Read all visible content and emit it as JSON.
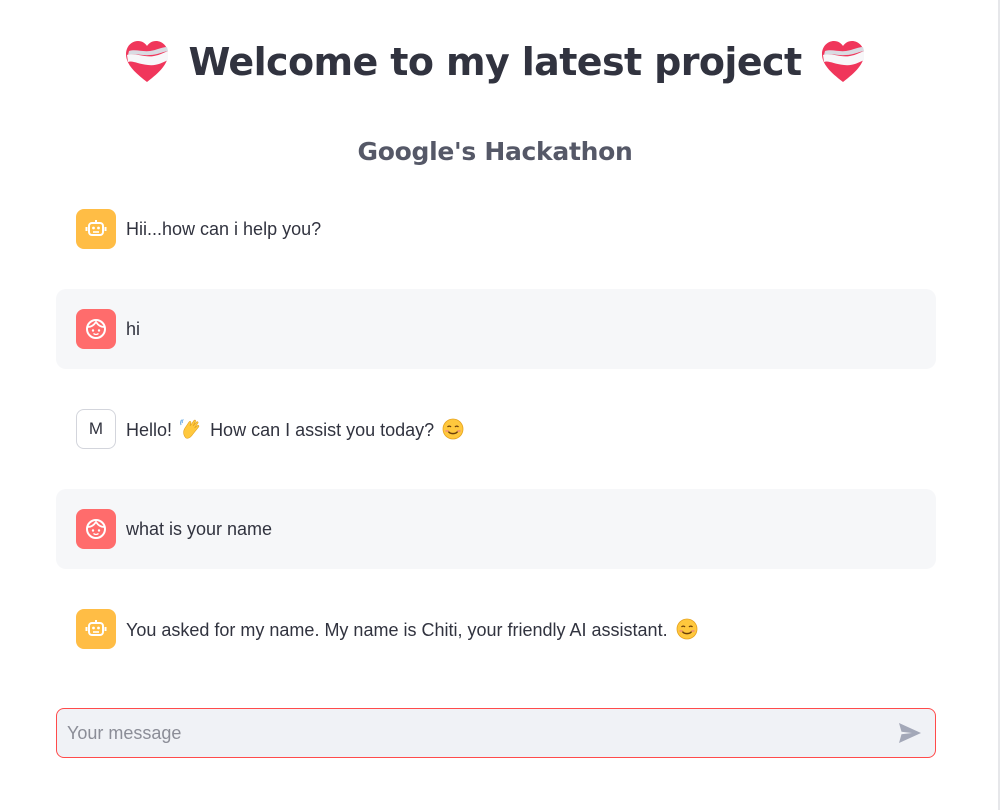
{
  "header": {
    "title": "Welcome to my latest project",
    "subtitle": "Google's Hackathon",
    "title_icon": "heart-ribbon-icon"
  },
  "messages": [
    {
      "role": "assistant",
      "avatar": "robot-icon",
      "text": "Hii...how can i help you?"
    },
    {
      "role": "user",
      "avatar": "user-face-icon",
      "text": "hi"
    },
    {
      "role": "assistant",
      "avatar_letter": "M",
      "text_before": "Hello!",
      "emoji_1": "waving-hand-icon",
      "text_middle": "How can I assist you today?",
      "emoji_2": "smiling-face-icon"
    },
    {
      "role": "user",
      "avatar": "user-face-icon",
      "text": "what is your name"
    },
    {
      "role": "assistant",
      "avatar": "robot-icon",
      "text": "You asked for my name. My name is Chiti, your friendly AI assistant.",
      "emoji": "smiling-face-icon"
    }
  ],
  "chat_input": {
    "placeholder": "Your message",
    "send_icon": "send-icon"
  },
  "colors": {
    "accent": "#ff4b4b",
    "bot_avatar": "#ffbd45",
    "user_avatar": "#ff6c6c",
    "user_bubble": "#f6f7f9",
    "input_bg": "#f0f2f6",
    "text": "#31333f"
  }
}
